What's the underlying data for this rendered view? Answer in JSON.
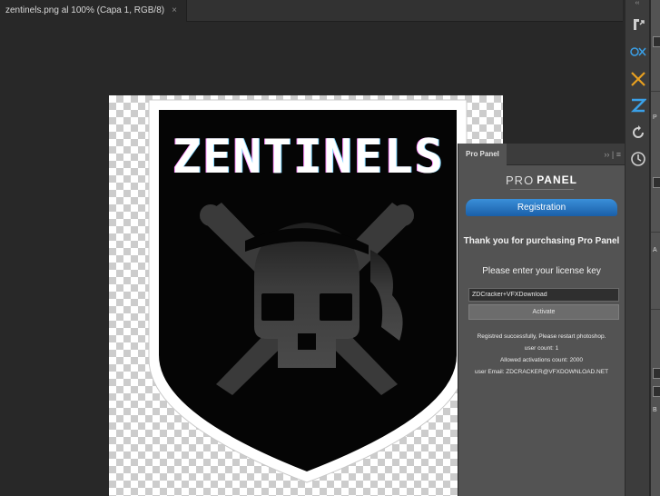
{
  "document_tab": {
    "title": "zentinels.png al 100% (Capa 1, RGB/8)",
    "close_glyph": "×"
  },
  "artwork": {
    "logo_text": "ZENTINELS"
  },
  "pro_panel": {
    "tab_label": "Pro Panel",
    "header_icons": "›› | ≡",
    "logo_part1": "PRO",
    "logo_part2": "PANEL",
    "registration_label": "Registration",
    "thanks_text": "Thank you for purchasing Pro Panel",
    "enter_text": "Please enter your license key",
    "license_value": "ZDCracker+VFXDownload",
    "activate_label": "Activate",
    "status_lines": [
      "Registred successfully, Please restart photoshop.",
      "user count: 1",
      "Allowed activations count: 2000",
      "user Email: ZDCRACKER@VFXDOWNLOAD.NET"
    ]
  },
  "dock": {
    "collapse_glyph": "‹‹",
    "buttons": [
      {
        "name": "actions-icon",
        "color": "#cfcfcf"
      },
      {
        "name": "ox-plugin-icon",
        "color": "#3aa0e8"
      },
      {
        "name": "crossed-tools-icon",
        "color": "#e8a020"
      },
      {
        "name": "zentinels-z-icon",
        "color": "#3aa0e8"
      },
      {
        "name": "refresh-icon",
        "color": "#cfcfcf"
      },
      {
        "name": "clock-icon",
        "color": "#cfcfcf"
      }
    ]
  },
  "right_panel": {
    "fragments": [
      "P",
      "A",
      "B"
    ]
  },
  "colors": {
    "accent_blue": "#1a5fa8",
    "canvas_bg": "#282828",
    "panel_bg": "#535353"
  }
}
